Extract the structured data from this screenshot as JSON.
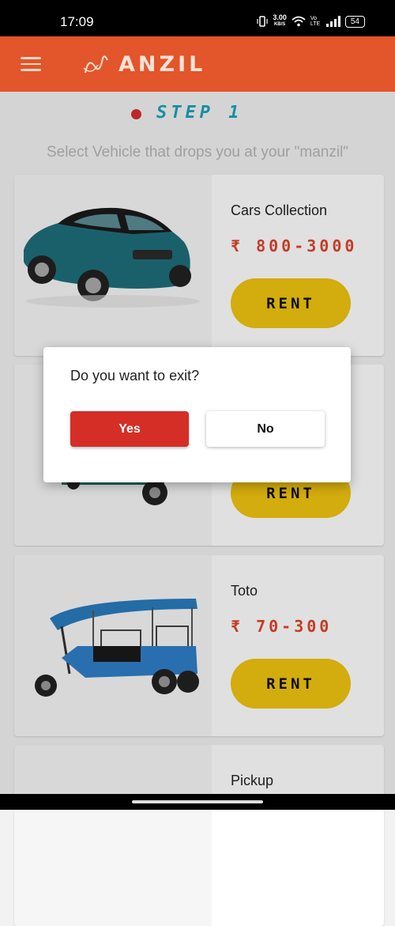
{
  "status_bar": {
    "time": "17:09",
    "net_speed": "3.00",
    "net_unit": "KB/S",
    "volte": "Vo LTE",
    "battery": "54"
  },
  "app_bar": {
    "logo_text": "ANZIL"
  },
  "step": {
    "title": "STEP 1",
    "subtitle": "Select Vehicle that drops you at your \"manzil\""
  },
  "cards": [
    {
      "title": "Cars Collection",
      "price": "₹ 800-3000",
      "rent_label": "RENT"
    },
    {
      "title": "",
      "price": "",
      "rent_label": "RENT"
    },
    {
      "title": "Toto",
      "price": "₹ 70-300",
      "rent_label": "RENT"
    },
    {
      "title": "Pickup",
      "price": "",
      "rent_label": ""
    }
  ],
  "dialog": {
    "question": "Do you want to exit?",
    "yes_label": "Yes",
    "no_label": "No"
  },
  "colors": {
    "app_bar": "#e3552a",
    "step_title": "#1aa3b8",
    "price": "#e0452b",
    "rent_button": "#f1c40f",
    "yes_button": "#d42e27"
  }
}
